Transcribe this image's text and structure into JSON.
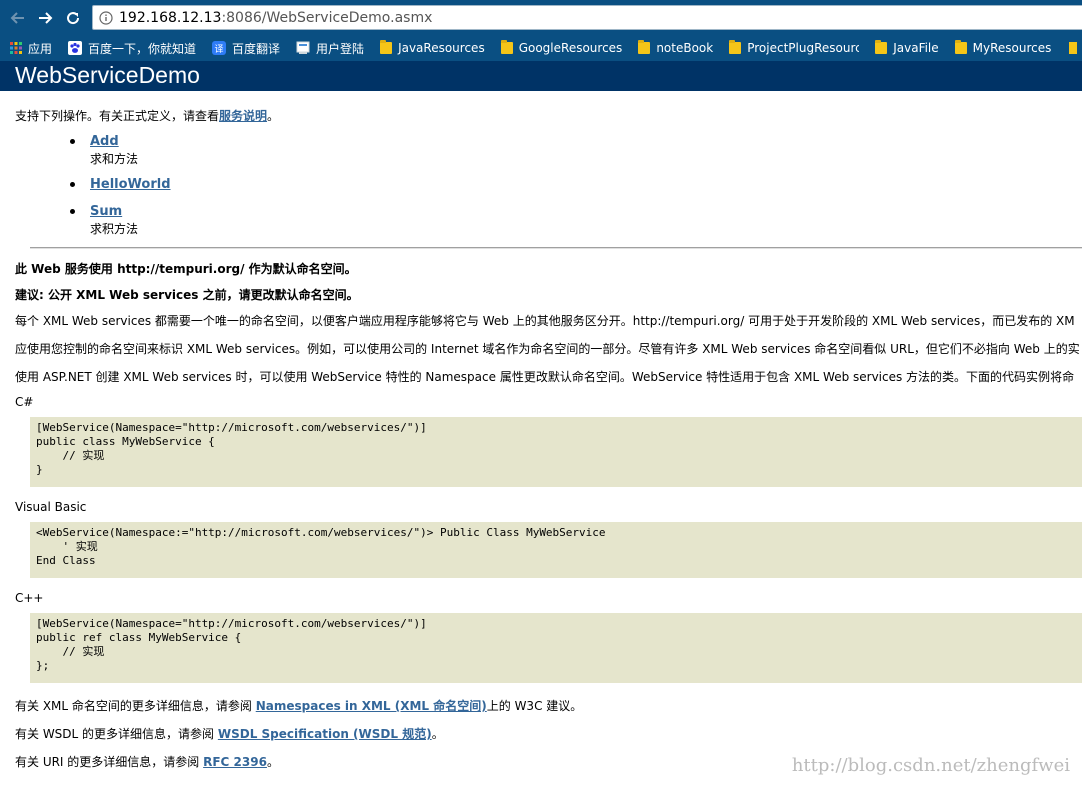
{
  "browser": {
    "url_host": "192.168.12.13",
    "url_rest": ":8086/WebServiceDemo.asmx",
    "bookmarks": [
      {
        "label": "应用",
        "icon": "apps-grid-icon"
      },
      {
        "label": "百度一下，你就知道",
        "icon": "baidu-paw-icon"
      },
      {
        "label": "百度翻译",
        "icon": "translate-icon"
      },
      {
        "label": "用户登陆",
        "icon": "page-icon"
      },
      {
        "label": "JavaResources",
        "icon": "folder-icon"
      },
      {
        "label": "GoogleResources",
        "icon": "folder-icon"
      },
      {
        "label": "noteBook",
        "icon": "folder-icon"
      },
      {
        "label": "ProjectPlugResourc",
        "icon": "folder-icon"
      },
      {
        "label": "JavaFile",
        "icon": "folder-icon"
      },
      {
        "label": "MyResources",
        "icon": "folder-icon"
      }
    ]
  },
  "page": {
    "title": "WebServiceDemo",
    "intro_prefix": "支持下列操作。有关正式定义，请查看",
    "intro_link": "服务说明",
    "intro_suffix": "。",
    "operations": [
      {
        "name": "Add",
        "desc": "求和方法"
      },
      {
        "name": "HelloWorld",
        "desc": ""
      },
      {
        "name": "Sum",
        "desc": "求积方法"
      }
    ],
    "ns_notice": "此 Web 服务使用 http://tempuri.org/ 作为默认命名空间。",
    "recommendation": "建议: 公开 XML Web services 之前，请更改默认命名空间。",
    "para1": "每个 XML Web services 都需要一个唯一的命名空间，以便客户端应用程序能够将它与 Web 上的其他服务区分开。http://tempuri.org/ 可用于处于开发阶段的 XML Web services，而已发布的 XM",
    "para2": "应使用您控制的命名空间来标识 XML Web services。例如，可以使用公司的 Internet 域名作为命名空间的一部分。尽管有许多 XML Web services 命名空间看似 URL，但它们不必指向 Web 上的实",
    "para3": "使用 ASP.NET 创建 XML Web services 时，可以使用 WebService 特性的 Namespace 属性更改默认命名空间。WebService 特性适用于包含 XML Web services 方法的类。下面的代码实例将命",
    "code_blocks": [
      {
        "lang": "C#",
        "lines": [
          "[WebService(Namespace=\"http://microsoft.com/webservices/\")]",
          "public class MyWebService {",
          "    // 实现",
          "}"
        ]
      },
      {
        "lang": "Visual Basic",
        "lines": [
          "<WebService(Namespace:=\"http://microsoft.com/webservices/\")> Public Class MyWebService",
          "    ' 实现",
          "End Class"
        ]
      },
      {
        "lang": "C++",
        "lines": [
          "[WebService(Namespace=\"http://microsoft.com/webservices/\")]",
          "public ref class MyWebService {",
          "    // 实现",
          "};"
        ]
      }
    ],
    "xml_info_prefix": "有关 XML 命名空间的更多详细信息，请参阅 ",
    "xml_info_link": "Namespaces in XML (XML 命名空间)",
    "xml_info_suffix": "上的 W3C 建议。",
    "wsdl_info_prefix": "有关 WSDL 的更多详细信息，请参阅 ",
    "wsdl_info_link": "WSDL Specification (WSDL 规范)",
    "wsdl_info_suffix": "。",
    "uri_info_prefix": "有关 URI 的更多详细信息，请参阅 ",
    "uri_info_link": "RFC 2396",
    "uri_info_suffix": "。",
    "watermark": "http://blog.csdn.net/zhengfwei"
  },
  "colors": {
    "chrome": "#0a4f82",
    "header_band": "#003366",
    "link": "#336699",
    "code_bg": "#e5e5cc"
  }
}
